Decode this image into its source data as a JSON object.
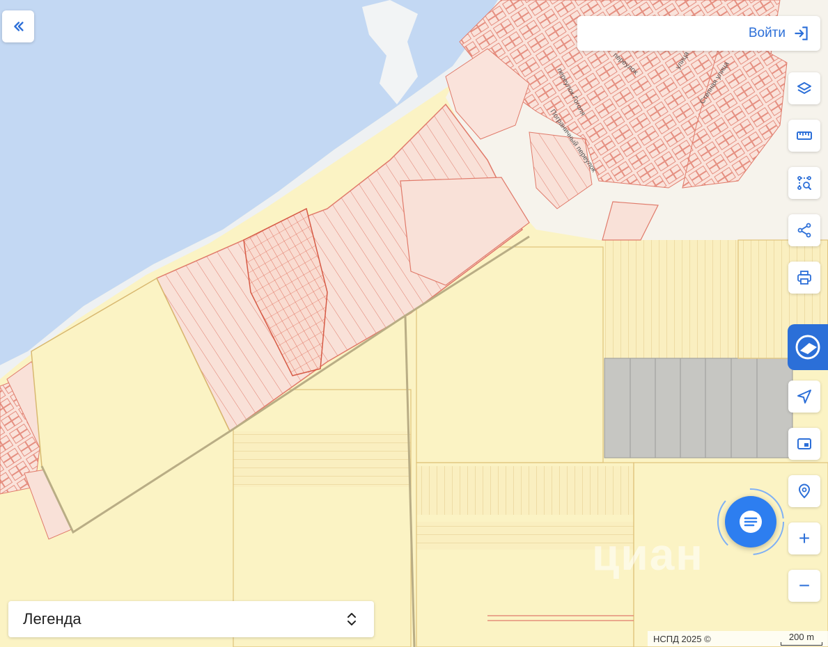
{
  "header": {
    "login_label": "Войти"
  },
  "toolbar": {
    "tools": [
      {
        "id": "layers",
        "icon": "layers-icon"
      },
      {
        "id": "ruler",
        "icon": "ruler-icon"
      },
      {
        "id": "area-select",
        "icon": "area-select-icon"
      },
      {
        "id": "share",
        "icon": "share-icon"
      },
      {
        "id": "print",
        "icon": "printer-icon"
      },
      {
        "id": "geolocate",
        "icon": "navigation-arrow-icon"
      },
      {
        "id": "minimap",
        "icon": "picture-in-picture-icon"
      },
      {
        "id": "search-location",
        "icon": "location-search-icon"
      }
    ],
    "zoom_in_label": "+",
    "zoom_out_label": "−"
  },
  "legend": {
    "label": "Легенда"
  },
  "attribution": {
    "text": "НСПД 2025 ©",
    "scale_label": "200 m"
  },
  "watermark": {
    "text": "циан"
  },
  "map": {
    "streets": [
      "переулок Гоголя",
      "переулок",
      "Степная улица",
      "улица",
      "Пограничный переулок"
    ]
  },
  "colors": {
    "water": "#c3d8f3",
    "parcel_fill": "#f9e1d8",
    "parcel_stroke": "#e07a6a",
    "farmland": "#fbf3c4",
    "accent": "#2c6fd8",
    "gray_block": "#c6c6c2"
  }
}
